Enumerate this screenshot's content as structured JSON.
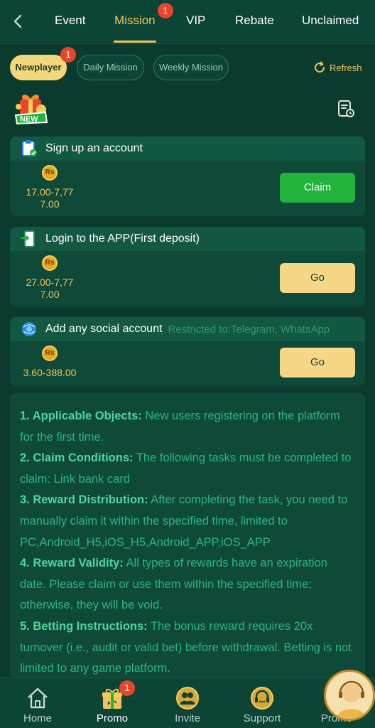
{
  "nav": {
    "tabs": [
      {
        "label": "Event"
      },
      {
        "label": "Mission",
        "badge": "1"
      },
      {
        "label": "VIP"
      },
      {
        "label": "Rebate"
      },
      {
        "label": "Unclaimed"
      }
    ],
    "active_tab": "Mission"
  },
  "subtabs": [
    {
      "label": "Newplayer",
      "badge": "1"
    },
    {
      "label": "Daily Mission"
    },
    {
      "label": "Weekly Mission"
    }
  ],
  "refresh_label": "Refresh",
  "gift_badge": "NEW",
  "missions": [
    {
      "title": "Sign up an account",
      "currency": "Rs",
      "amount_line1": "17.00-7,77",
      "amount_line2": "7.00",
      "button": "Claim"
    },
    {
      "title": "Login to the APP(First deposit)",
      "currency": "Rs",
      "amount_line1": "27.00-7,77",
      "amount_line2": "7.00",
      "button": "Go"
    },
    {
      "title": "Add any social account",
      "restriction": "Restricted to:Telegram, WhatsApp",
      "currency": "Rs",
      "amount_line1": "3.60-388.00",
      "button": "Go"
    }
  ],
  "rules": [
    {
      "label": "1. Applicable Objects:",
      "text": " New users registering on the platform for the first time."
    },
    {
      "label": "2. Claim Conditions:",
      "text": " The following tasks must be completed to claim: Link bank card"
    },
    {
      "label": "3. Reward Distribution:",
      "text": " After completing the task, you need to manually claim it within the specified time, limited to PC,Android_H5,iOS_H5,Android_APP,iOS_APP"
    },
    {
      "label": "4. Reward Validity:",
      "text": " All types of rewards have an expiration date. Please claim or use them within the specified time; otherwise, they will be void."
    },
    {
      "label": "5. Betting Instructions:",
      "text": " The bonus reward requires 20x turnover (i.e., audit or valid bet) before withdrawal. Betting is not limited to any game platform."
    }
  ],
  "bottom_nav": [
    {
      "label": "Home",
      "icon": "home-icon"
    },
    {
      "label": "Promo",
      "icon": "gift-icon",
      "badge": "1"
    },
    {
      "label": "Invite",
      "icon": "invite-icon"
    },
    {
      "label": "Support",
      "icon": "support-icon"
    },
    {
      "label": "Promo",
      "icon": "agent-avatar-icon"
    }
  ],
  "colors": {
    "background": "#0b3b2e",
    "accent": "#f2c25b",
    "claim_button": "#21b33c",
    "go_button": "#f6d788",
    "rule_text": "#2cb386",
    "badge": "#e8462c"
  }
}
